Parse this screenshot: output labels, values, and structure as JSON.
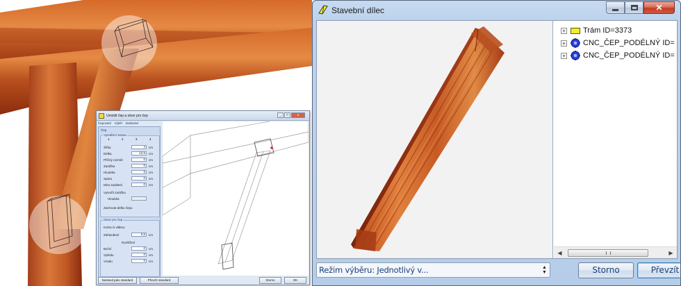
{
  "window": {
    "title": "Stavební dílec",
    "close_glyph": "✕"
  },
  "tree": {
    "items": [
      {
        "label": "Trám ID=3373",
        "icon": "beam-icon",
        "expander": "+"
      },
      {
        "label": "CNC_ČEP_PODÉLNÝ ID=",
        "icon": "gear-icon",
        "expander": "+"
      },
      {
        "label": "CNC_ČEP_PODÉLNÝ ID=",
        "icon": "gear-icon",
        "expander": "+"
      }
    ]
  },
  "scrollbar": {
    "left_arrow": "◀",
    "right_arrow": "▶"
  },
  "footer": {
    "selection_mode": "Režim výběru: Jednotlivý v...",
    "storno_label": "Storno",
    "prevzit_label": "Převzít"
  },
  "inner_dialog": {
    "title": "Umístit čep a otvor pro čep",
    "tabs": [
      "Čepování",
      "Výběr",
      "Zadávání"
    ],
    "section_label": "Čep",
    "group_label": "Vytváření strana",
    "radio_options": [
      "1",
      "2",
      "3",
      "4"
    ],
    "rows": [
      {
        "label": "Šířka",
        "value": "4",
        "unit": "cm"
      },
      {
        "label": "Délka",
        "value": "12,5",
        "unit": "cm"
      },
      {
        "label": "Příčný rozměr",
        "value": "0",
        "unit": "cm"
      },
      {
        "label": "Zaráž­ka",
        "value": "0",
        "unit": "cm"
      },
      {
        "label": "Hloubka",
        "value": "5",
        "unit": "cm"
      },
      {
        "label": "Spára",
        "value": "0",
        "unit": "cm"
      },
      {
        "label": "Míra zaoblení",
        "value": "0",
        "unit": "cm"
      }
    ],
    "check_label": "Vytvořit zarážku",
    "depth_label": "Hloubka",
    "check2_label": "Zachovat délku čepu",
    "otvor_label": "Otvor pro čep",
    "kolmo_label": "Kolmo k vláknu",
    "zahloubeni_label": "Zahloubení",
    "zahloubeni_value": "0,5",
    "vypustek_label": "Rozšíření",
    "vrows": [
      {
        "label": "Boční",
        "value": "0",
        "unit": "cm"
      },
      {
        "label": "Vpředu",
        "value": "0",
        "unit": "cm"
      },
      {
        "label": "Vzadu",
        "value": "0",
        "unit": "cm"
      }
    ],
    "btn_default": "Nastavit jako standard",
    "btn_load": "Převzít standard",
    "btn_storno": "Storno",
    "btn_ok": "OK"
  },
  "colors": {
    "wood_dark": "#8a2a0a",
    "wood_mid": "#c4561e",
    "wood_light": "#e08a3c",
    "beam_icon": "#f3ee2b"
  }
}
